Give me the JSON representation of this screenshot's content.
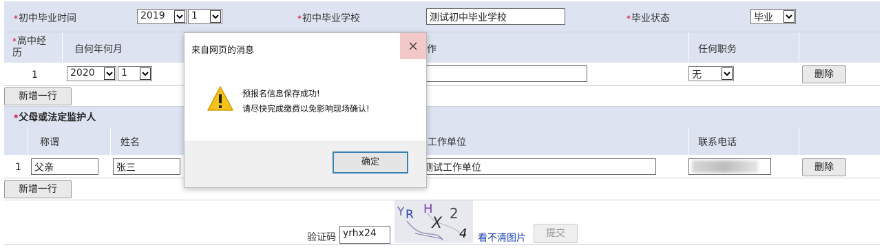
{
  "row1": {
    "jhs_time_label": "初中毕业时间",
    "jhs_year": "2019",
    "jhs_month": "1",
    "jhs_school_label": "初中毕业学校",
    "jhs_school_value": "测试初中毕业学校",
    "grad_status_label": "毕业状态",
    "grad_status_value": "毕业"
  },
  "hs": {
    "section_label_1": "高中经",
    "section_label_2": "历",
    "col_from": "自何年何月",
    "col_work_partial": "作",
    "col_position": "任何职务",
    "row_index": "1",
    "row_year": "2020",
    "row_month": "1",
    "row_unit_partial": "J",
    "row_position": "无",
    "delete_label": "删除",
    "add_row_label": "新增一行"
  },
  "guardian": {
    "section_label": "父母或法定监护人",
    "col_relation": "称谓",
    "col_name": "姓名",
    "col_unit": "工作单位",
    "col_phone": "联系电话",
    "row_index": "1",
    "row_relation": "父亲",
    "row_name": "张三",
    "row_unit": "测试工作单位",
    "delete_label": "删除",
    "add_row_label": "新增一行"
  },
  "captcha": {
    "label": "验证码",
    "value": "yrhx24",
    "image_text": "YRHX24",
    "refresh_link": "看不清图片",
    "submit_label": "提交"
  },
  "dialog": {
    "title": "来自网页的消息",
    "line1": "预报名信息保存成功!",
    "line2": "请尽快完成缴费以免影响现场确认!",
    "ok_label": "确定",
    "icon": "warning-icon"
  },
  "colors": {
    "header_band": "#dde3f0",
    "required_mark": "#d6002a",
    "link": "#1a3fb0",
    "dialog_close_bg": "#f3c8c8"
  }
}
